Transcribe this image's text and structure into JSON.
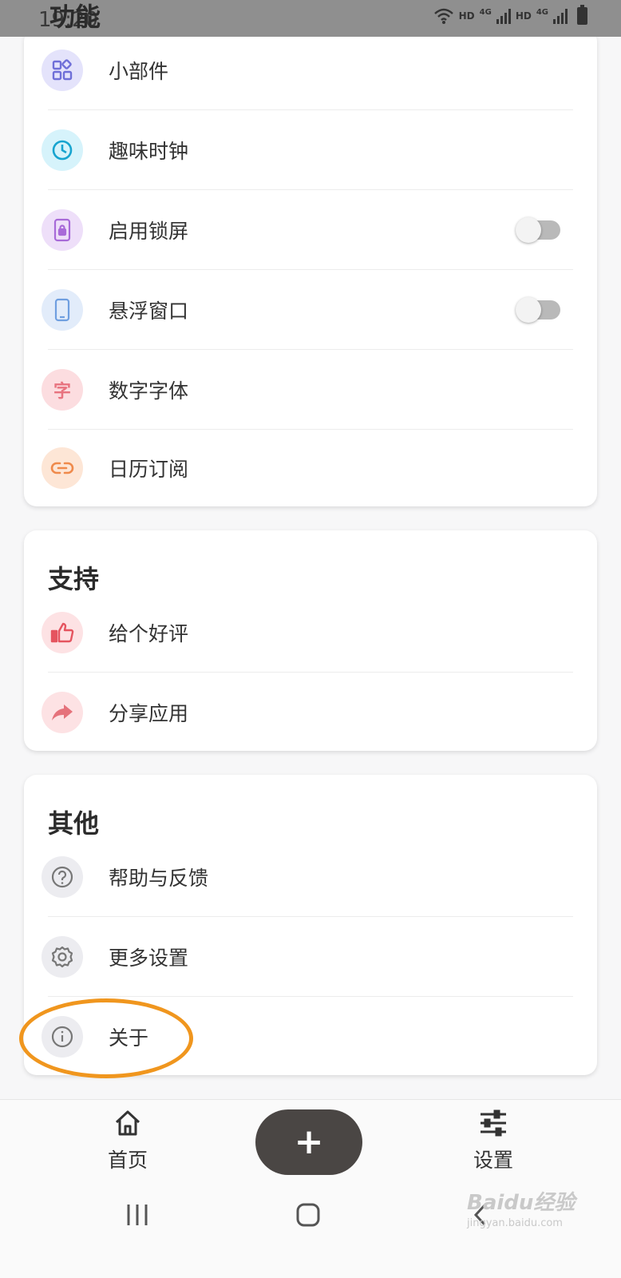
{
  "status_bar": {
    "time": "19:20",
    "hd1": "HD",
    "net1": "4G",
    "hd2": "HD",
    "net2": "4G"
  },
  "section_peek_title": "功能",
  "feature_card": {
    "items": [
      {
        "label": "小部件",
        "icon": "widgets-icon",
        "bg": "#e4e3fb",
        "fg": "#6f6fd8"
      },
      {
        "label": "趣味时钟",
        "icon": "clock-icon",
        "bg": "#d6f3fb",
        "fg": "#17a4cf"
      },
      {
        "label": "启用锁屏",
        "icon": "lock-screen-icon",
        "bg": "#eedff9",
        "fg": "#a86ad8",
        "toggle": false
      },
      {
        "label": "悬浮窗口",
        "icon": "phone-icon",
        "bg": "#e2ecfa",
        "fg": "#6f9fe0",
        "toggle": false
      },
      {
        "label": "数字字体",
        "icon": "character-icon",
        "glyph": "字",
        "bg": "#fcdde0",
        "fg": "#e8737f"
      },
      {
        "label": "日历订阅",
        "icon": "link-icon",
        "bg": "#fde6d6",
        "fg": "#ef8a4b"
      }
    ]
  },
  "support_card": {
    "title": "支持",
    "items": [
      {
        "label": "给个好评",
        "icon": "thumbs-up-icon",
        "bg": "#fde2e4",
        "fg": "#e5545f"
      },
      {
        "label": "分享应用",
        "icon": "share-icon",
        "bg": "#fde2e4",
        "fg": "#e5727b"
      }
    ]
  },
  "other_card": {
    "title": "其他",
    "items": [
      {
        "label": "帮助与反馈",
        "icon": "help-icon",
        "bg": "#ececf0",
        "fg": "#777"
      },
      {
        "label": "更多设置",
        "icon": "gear-icon",
        "bg": "#ececf0",
        "fg": "#777"
      },
      {
        "label": "关于",
        "icon": "info-icon",
        "bg": "#ececf0",
        "fg": "#777"
      }
    ]
  },
  "bottom_nav": {
    "home_label": "首页",
    "settings_label": "设置",
    "add_glyph": "+"
  },
  "watermark": {
    "main": "Baidu经验",
    "sub": "jingyan.baidu.com"
  },
  "colors": {
    "highlight": "#f0961e",
    "fab": "#4a4644"
  }
}
